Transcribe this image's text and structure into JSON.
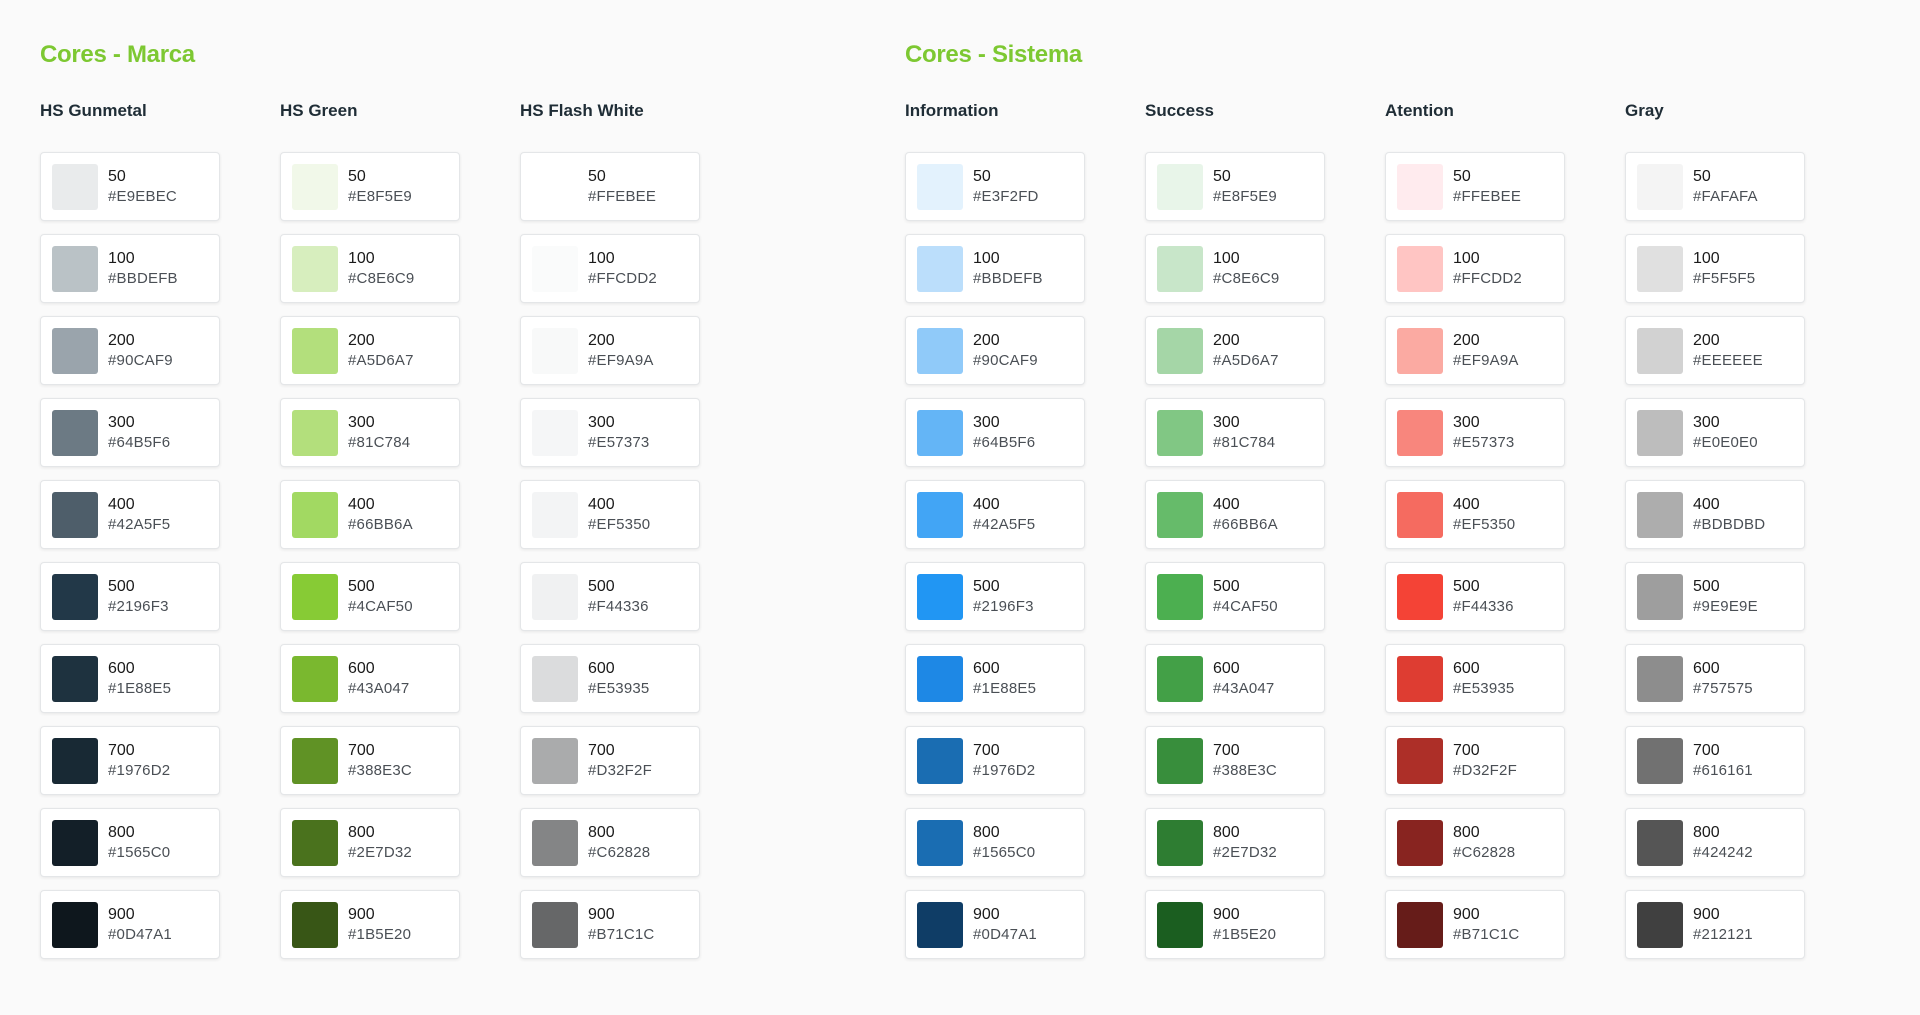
{
  "accent_color": "#7dc832",
  "sections": [
    {
      "title": "Cores - Marca",
      "palettes": [
        {
          "name": "HS Gunmetal",
          "swatches": [
            {
              "shade": "50",
              "hex": "#E9EBEC",
              "fill": "#E9EBEC"
            },
            {
              "shade": "100",
              "hex": "#BBDEFB",
              "fill": "#BAC2C6"
            },
            {
              "shade": "200",
              "hex": "#90CAF9",
              "fill": "#9AA4AC"
            },
            {
              "shade": "300",
              "hex": "#64B5F6",
              "fill": "#6C7A84"
            },
            {
              "shade": "400",
              "hex": "#42A5F5",
              "fill": "#4E5E6A"
            },
            {
              "shade": "500",
              "hex": "#2196F3",
              "fill": "#223848"
            },
            {
              "shade": "600",
              "hex": "#1E88E5",
              "fill": "#1E323F"
            },
            {
              "shade": "700",
              "hex": "#1976D2",
              "fill": "#182934"
            },
            {
              "shade": "800",
              "hex": "#1565C0",
              "fill": "#131F28"
            },
            {
              "shade": "900",
              "hex": "#0D47A1",
              "fill": "#0E171D"
            }
          ]
        },
        {
          "name": "HS Green",
          "swatches": [
            {
              "shade": "50",
              "hex": "#E8F5E9",
              "fill": "#F1F8E9"
            },
            {
              "shade": "100",
              "hex": "#C8E6C9",
              "fill": "#D7EEBE"
            },
            {
              "shade": "200",
              "hex": "#A5D6A7",
              "fill": "#B3DF7C"
            },
            {
              "shade": "300",
              "hex": "#81C784",
              "fill": "#B3DF7C"
            },
            {
              "shade": "400",
              "hex": "#66BB6A",
              "fill": "#A2D962"
            },
            {
              "shade": "500",
              "hex": "#4CAF50",
              "fill": "#87CB35"
            },
            {
              "shade": "600",
              "hex": "#43A047",
              "fill": "#7AB82F"
            },
            {
              "shade": "700",
              "hex": "#388E3C",
              "fill": "#609225"
            },
            {
              "shade": "800",
              "hex": "#2E7D32",
              "fill": "#4A721D"
            },
            {
              "shade": "900",
              "hex": "#1B5E20",
              "fill": "#385616"
            }
          ]
        },
        {
          "name": "HS Flash White",
          "swatches": [
            {
              "shade": "50",
              "hex": "#FFEBEE",
              "fill": "#FFFFFF"
            },
            {
              "shade": "100",
              "hex": "#FFCDD2",
              "fill": "#FAFBFB"
            },
            {
              "shade": "200",
              "hex": "#EF9A9A",
              "fill": "#F8F9F9"
            },
            {
              "shade": "300",
              "hex": "#E57373",
              "fill": "#F5F6F7"
            },
            {
              "shade": "400",
              "hex": "#EF5350",
              "fill": "#F3F4F5"
            },
            {
              "shade": "500",
              "hex": "#F44336",
              "fill": "#F0F1F2"
            },
            {
              "shade": "600",
              "hex": "#E53935",
              "fill": "#DBDCDD"
            },
            {
              "shade": "700",
              "hex": "#D32F2F",
              "fill": "#AAABAC"
            },
            {
              "shade": "800",
              "hex": "#C62828",
              "fill": "#848586"
            },
            {
              "shade": "900",
              "hex": "#B71C1C",
              "fill": "#666768"
            }
          ]
        }
      ]
    },
    {
      "title": "Cores - Sistema",
      "palettes": [
        {
          "name": "Information",
          "swatches": [
            {
              "shade": "50",
              "hex": "#E3F2FD",
              "fill": "#E3F2FD"
            },
            {
              "shade": "100",
              "hex": "#BBDEFB",
              "fill": "#BBDEFB"
            },
            {
              "shade": "200",
              "hex": "#90CAF9",
              "fill": "#90CAF9"
            },
            {
              "shade": "300",
              "hex": "#64B5F6",
              "fill": "#64B5F6"
            },
            {
              "shade": "400",
              "hex": "#42A5F5",
              "fill": "#42A5F5"
            },
            {
              "shade": "500",
              "hex": "#2196F3",
              "fill": "#2196F3"
            },
            {
              "shade": "600",
              "hex": "#1E88E5",
              "fill": "#1E88E5"
            },
            {
              "shade": "700",
              "hex": "#1976D2",
              "fill": "#1A6DB2"
            },
            {
              "shade": "800",
              "hex": "#1565C0",
              "fill": "#1A6DB2"
            },
            {
              "shade": "900",
              "hex": "#0D47A1",
              "fill": "#0F3D66"
            }
          ]
        },
        {
          "name": "Success",
          "swatches": [
            {
              "shade": "50",
              "hex": "#E8F5E9",
              "fill": "#E8F5E9"
            },
            {
              "shade": "100",
              "hex": "#C8E6C9",
              "fill": "#C8E6C9"
            },
            {
              "shade": "200",
              "hex": "#A5D6A7",
              "fill": "#A5D6A7"
            },
            {
              "shade": "300",
              "hex": "#81C784",
              "fill": "#81C784"
            },
            {
              "shade": "400",
              "hex": "#66BB6A",
              "fill": "#66BB6A"
            },
            {
              "shade": "500",
              "hex": "#4CAF50",
              "fill": "#4CAF50"
            },
            {
              "shade": "600",
              "hex": "#43A047",
              "fill": "#43A047"
            },
            {
              "shade": "700",
              "hex": "#388E3C",
              "fill": "#388E3C"
            },
            {
              "shade": "800",
              "hex": "#2E7D32",
              "fill": "#2E7D32"
            },
            {
              "shade": "900",
              "hex": "#1B5E20",
              "fill": "#1B5E20"
            }
          ]
        },
        {
          "name": "Atention",
          "swatches": [
            {
              "shade": "50",
              "hex": "#FFEBEE",
              "fill": "#FFEBEE"
            },
            {
              "shade": "100",
              "hex": "#FFCDD2",
              "fill": "#FFC5C3"
            },
            {
              "shade": "200",
              "hex": "#EF9A9A",
              "fill": "#FBAAA2"
            },
            {
              "shade": "300",
              "hex": "#E57373",
              "fill": "#F8867D"
            },
            {
              "shade": "400",
              "hex": "#EF5350",
              "fill": "#F56B60"
            },
            {
              "shade": "500",
              "hex": "#F44336",
              "fill": "#F44336"
            },
            {
              "shade": "600",
              "hex": "#E53935",
              "fill": "#DE3D32"
            },
            {
              "shade": "700",
              "hex": "#D32F2F",
              "fill": "#AD2F28"
            },
            {
              "shade": "800",
              "hex": "#C62828",
              "fill": "#882420"
            },
            {
              "shade": "900",
              "hex": "#B71C1C",
              "fill": "#661C19"
            }
          ]
        },
        {
          "name": "Gray",
          "swatches": [
            {
              "shade": "50",
              "hex": "#FAFAFA",
              "fill": "#F4F4F4"
            },
            {
              "shade": "100",
              "hex": "#F5F5F5",
              "fill": "#E0E0E0"
            },
            {
              "shade": "200",
              "hex": "#EEEEEE",
              "fill": "#D2D2D2"
            },
            {
              "shade": "300",
              "hex": "#E0E0E0",
              "fill": "#BDBDBD"
            },
            {
              "shade": "400",
              "hex": "#BDBDBD",
              "fill": "#ADADAD"
            },
            {
              "shade": "500",
              "hex": "#9E9E9E",
              "fill": "#9E9E9E"
            },
            {
              "shade": "600",
              "hex": "#757575",
              "fill": "#8D8D8D"
            },
            {
              "shade": "700",
              "hex": "#616161",
              "fill": "#717171"
            },
            {
              "shade": "800",
              "hex": "#424242",
              "fill": "#555555"
            },
            {
              "shade": "900",
              "hex": "#212121",
              "fill": "#404040"
            }
          ]
        }
      ]
    }
  ]
}
